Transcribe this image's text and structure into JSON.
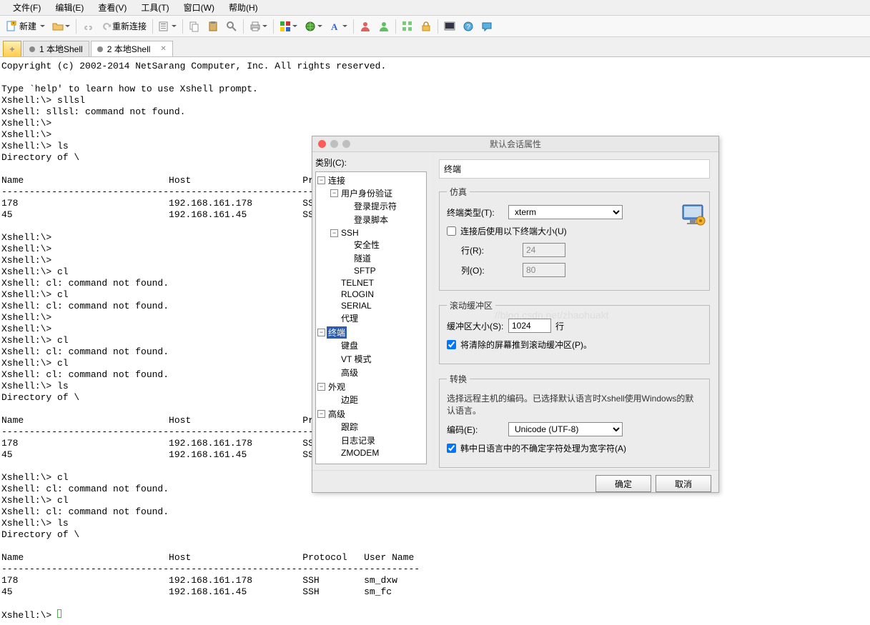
{
  "menu": {
    "file": "文件(F)",
    "edit": "编辑(E)",
    "view": "查看(V)",
    "tools": "工具(T)",
    "window": "窗口(W)",
    "help": "帮助(H)"
  },
  "toolbar": {
    "new": "新建",
    "reconnect": "重新连接"
  },
  "tabs": {
    "t1": "1 本地Shell",
    "t2": "2 本地Shell"
  },
  "terminal": "Copyright (c) 2002-2014 NetSarang Computer, Inc. All rights reserved.\n\nType `help' to learn how to use Xshell prompt.\nXshell:\\> sllsl\nXshell: sllsl: command not found.\nXshell:\\> \nXshell:\\> \nXshell:\\> ls\nDirectory of \\\n\nName                          Host                    Protocol   User\n--------------------------------------------------------------------\n178                           192.168.161.178         SSH        sm_\n45                            192.168.161.45          SSH        sm_\n\nXshell:\\> \nXshell:\\> \nXshell:\\> \nXshell:\\> cl\nXshell: cl: command not found.\nXshell:\\> cl\nXshell: cl: command not found.\nXshell:\\> \nXshell:\\> \nXshell:\\> cl\nXshell: cl: command not found.\nXshell:\\> cl\nXshell: cl: command not found.\nXshell:\\> ls\nDirectory of \\\n\nName                          Host                    Protocol   User\n--------------------------------------------------------------------\n178                           192.168.161.178         SSH        sm_\n45                            192.168.161.45          SSH        sm_\n\nXshell:\\> cl\nXshell: cl: command not found.\nXshell:\\> cl\nXshell: cl: command not found.\nXshell:\\> ls\nDirectory of \\\n\nName                          Host                    Protocol   User Name\n---------------------------------------------------------------------------\n178                           192.168.161.178         SSH        sm_dxw\n45                            192.168.161.45          SSH        sm_fc\n\nXshell:\\> ",
  "dialog": {
    "title": "默认会话属性",
    "cat_label": "类别(C):",
    "banner": "终端",
    "tree": {
      "conn": "连接",
      "auth": "用户身份验证",
      "prompt": "登录提示符",
      "script": "登录脚本",
      "ssh": "SSH",
      "security": "安全性",
      "tunnel": "隧道",
      "sftp": "SFTP",
      "telnet": "TELNET",
      "rlogin": "RLOGIN",
      "serial": "SERIAL",
      "proxy": "代理",
      "term": "终端",
      "keyboard": "键盘",
      "vt": "VT 模式",
      "advanced": "高级",
      "look": "外观",
      "margin": "边距",
      "adv2": "高级",
      "trace": "跟踪",
      "log": "日志记录",
      "zmodem": "ZMODEM"
    },
    "sim": {
      "legend": "仿真",
      "type_label": "终端类型(T):",
      "type_value": "xterm",
      "use_size": "连接后使用以下终端大小(U)",
      "rows_label": "行(R):",
      "rows_value": "24",
      "cols_label": "列(O):",
      "cols_value": "80"
    },
    "scroll": {
      "legend": "滚动缓冲区",
      "buf_label": "缓冲区大小(S):",
      "buf_value": "1024",
      "unit": "行",
      "push": "将清除的屏幕推到滚动缓冲区(P)。"
    },
    "conv": {
      "legend": "转换",
      "note": "选择远程主机的编码。已选择默认语言时Xshell使用Windows的默认语言。",
      "enc_label": "编码(E):",
      "enc_value": "Unicode (UTF-8)",
      "cjk": "韩中日语言中的不确定字符处理为宽字符(A)"
    },
    "ok": "确定",
    "cancel": "取消"
  },
  "watermark": "//blog.csdn.net/zhaohuakt"
}
